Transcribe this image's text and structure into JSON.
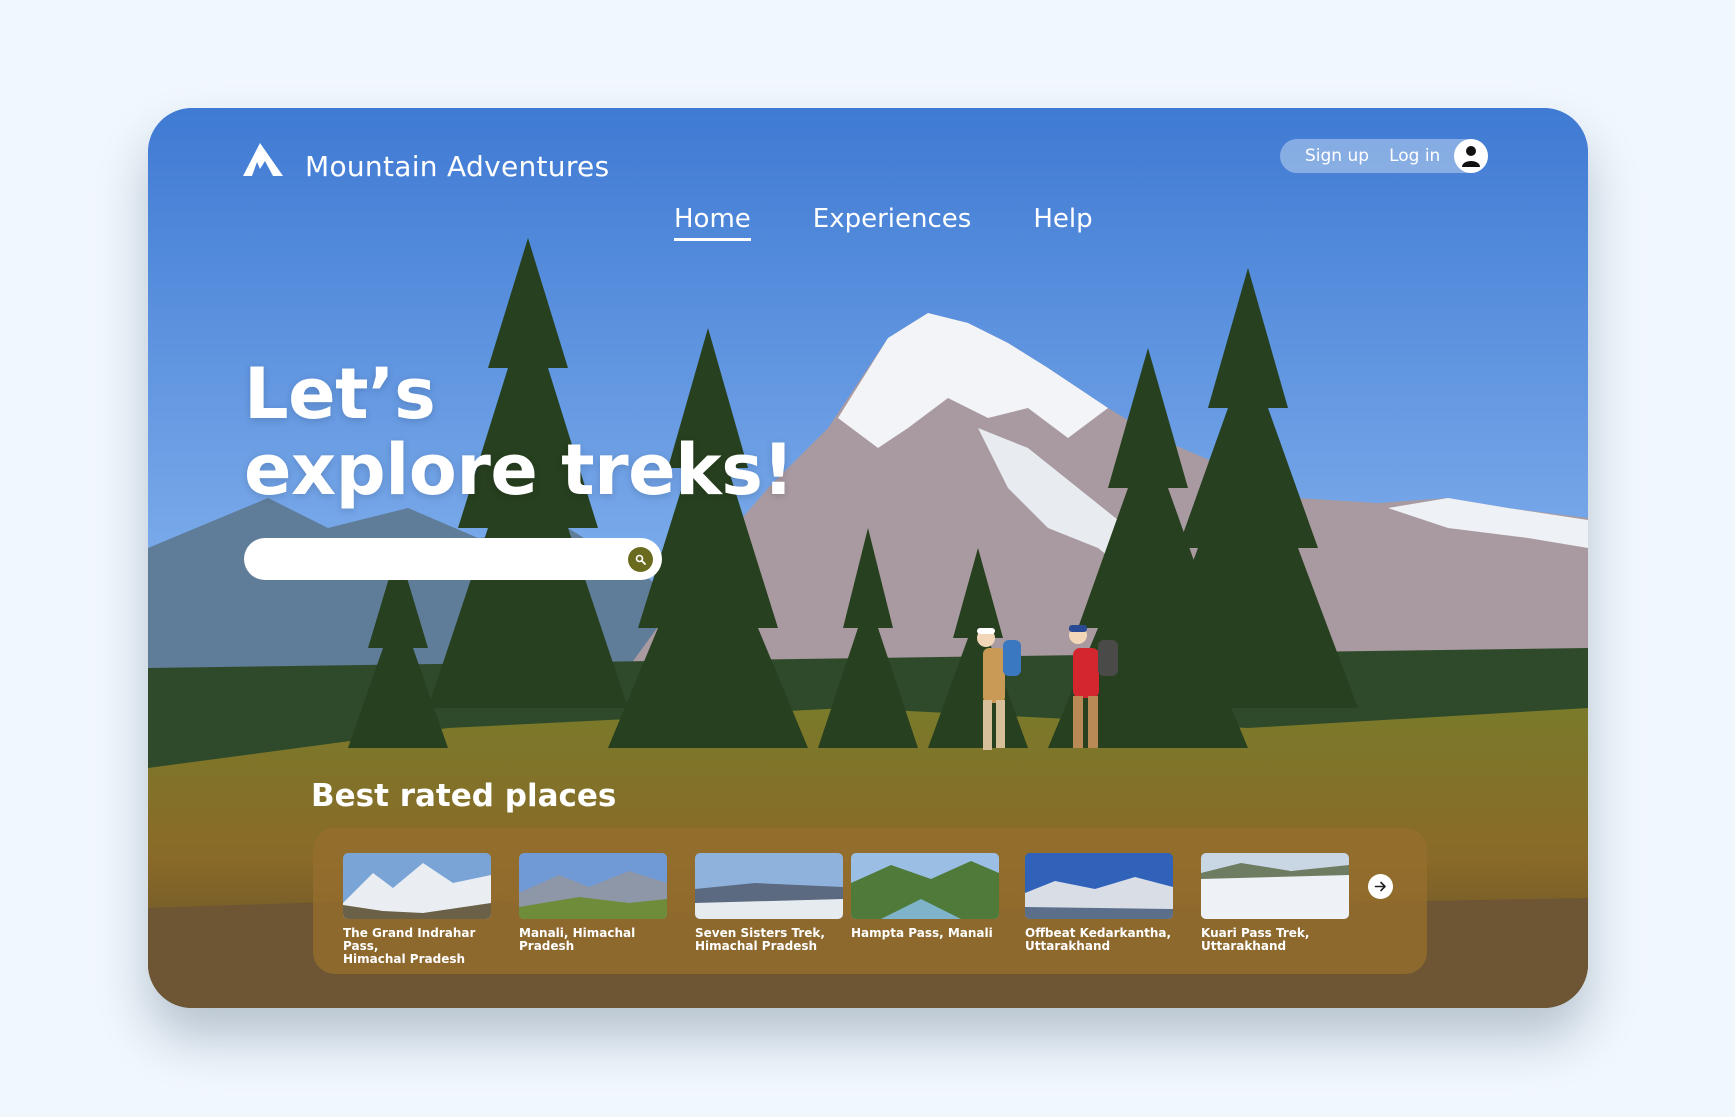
{
  "brand": {
    "name": "Mountain Adventures",
    "logo_icon": "mountain-peak-icon"
  },
  "auth": {
    "signup_label": "Sign up",
    "login_label": "Log in",
    "avatar_icon": "user-icon"
  },
  "nav": {
    "items": [
      {
        "label": "Home",
        "active": true
      },
      {
        "label": "Experiences"
      },
      {
        "label": "Help"
      }
    ]
  },
  "hero": {
    "line1": "Let’s",
    "line2": "explore treks!"
  },
  "search": {
    "placeholder": "",
    "value": "",
    "icon": "search-icon"
  },
  "places": {
    "title": "Best rated places",
    "items": [
      {
        "name": "The Grand Indrahar Pass,\nHimachal Pradesh"
      },
      {
        "name": "Manali, Himachal Pradesh"
      },
      {
        "name": "Seven Sisters Trek,\nHimachal Pradesh"
      },
      {
        "name": "Hampta Pass, Manali"
      },
      {
        "name": "Offbeat Kedarkantha,\nUttarakhand"
      },
      {
        "name": "Kuari Pass Trek,\nUttarakhand"
      }
    ],
    "next_icon": "arrow-right-icon"
  },
  "colors": {
    "page_bg": "#f0f7fd",
    "search_button": "#6b6b1f",
    "places_panel": "#966e2d"
  }
}
